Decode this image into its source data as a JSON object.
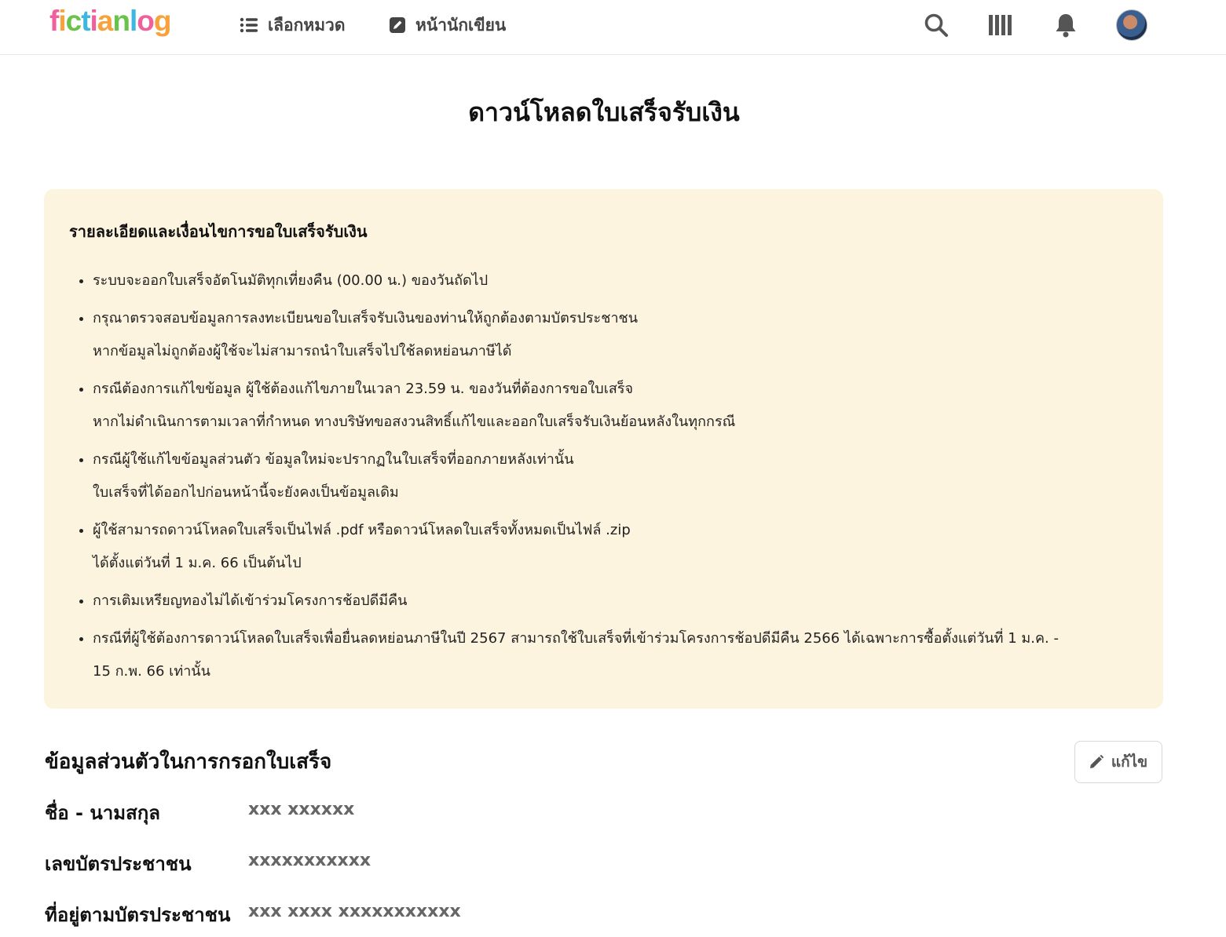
{
  "header": {
    "logo_letters": [
      "f",
      "i",
      "c",
      "t",
      "i",
      "a",
      "n",
      "l",
      "o",
      "g"
    ],
    "logo_colors": [
      "#f0609a",
      "#f7a23b",
      "#6bc24a",
      "#3db6e0",
      "#f0609a",
      "#f7a23b",
      "#6bc24a",
      "#3db6e0",
      "#f0609a",
      "#f7a23b"
    ],
    "nav_genre_label": "เลือกหมวด",
    "nav_writer_label": "หน้านักเขียน"
  },
  "page": {
    "title": "ดาวน์โหลดใบเสร็จรับเงิน"
  },
  "info": {
    "heading": "รายละเอียดและเงื่อนไขการขอใบเสร็จรับเงิน",
    "items": [
      {
        "line1": "ระบบจะออกใบเสร็จอัตโนมัติทุกเที่ยงคืน (00.00 น.) ของวันถัดไป",
        "line2": ""
      },
      {
        "line1": "กรุณาตรวจสอบข้อมูลการลงทะเบียนขอใบเสร็จรับเงินของท่านให้ถูกต้องตามบัตรประชาชน",
        "line2": "หากข้อมูลไม่ถูกต้องผู้ใช้จะไม่สามารถนำใบเสร็จไปใช้ลดหย่อนภาษีได้"
      },
      {
        "line1": "กรณีต้องการแก้ไขข้อมูล ผู้ใช้ต้องแก้ไขภายในเวลา 23.59 น. ของวันที่ต้องการขอใบเสร็จ",
        "line2": "หากไม่ดำเนินการตามเวลาที่กำหนด ทางบริษัทขอสงวนสิทธิ์แก้ไขและออกใบเสร็จรับเงินย้อนหลังในทุกกรณี"
      },
      {
        "line1": "กรณีผู้ใช้แก้ไขข้อมูลส่วนตัว ข้อมูลใหม่จะปรากฏในใบเสร็จที่ออกภายหลังเท่านั้น",
        "line2": "ใบเสร็จที่ได้ออกไปก่อนหน้านี้จะยังคงเป็นข้อมูลเดิม"
      },
      {
        "line1": "ผู้ใช้สามารถดาวน์โหลดใบเสร็จเป็นไฟล์ .pdf หรือดาวน์โหลดใบเสร็จทั้งหมดเป็นไฟล์ .zip",
        "line2": "ได้ตั้งแต่วันที่ 1 ม.ค. 66 เป็นต้นไป"
      },
      {
        "line1": "การเติมเหรียญทองไม่ได้เข้าร่วมโครงการช้อปดีมีคืน",
        "line2": ""
      },
      {
        "line1": "กรณีที่ผู้ใช้ต้องการดาวน์โหลดใบเสร็จเพื่อยื่นลดหย่อนภาษีในปี 2567 สามารถใช้ใบเสร็จที่เข้าร่วมโครงการช้อปดีมีคืน 2566 ได้เฉพาะการซื้อตั้งแต่วันที่ 1 ม.ค. -",
        "line2": "15 ก.พ. 66 เท่านั้น"
      }
    ]
  },
  "personal": {
    "section_title": "ข้อมูลส่วนตัวในการกรอกใบเสร็จ",
    "edit_label": "แก้ไข",
    "fields": [
      {
        "label": "ชื่อ - นามสกุล",
        "value": "xxx xxxxxx"
      },
      {
        "label": "เลขบัตรประชาชน",
        "value": "xxxxxxxxxxx"
      },
      {
        "label": "ที่อยู่ตามบัตรประชาชน",
        "value": "xxx xxxx xxxxxxxxxxx"
      }
    ]
  }
}
